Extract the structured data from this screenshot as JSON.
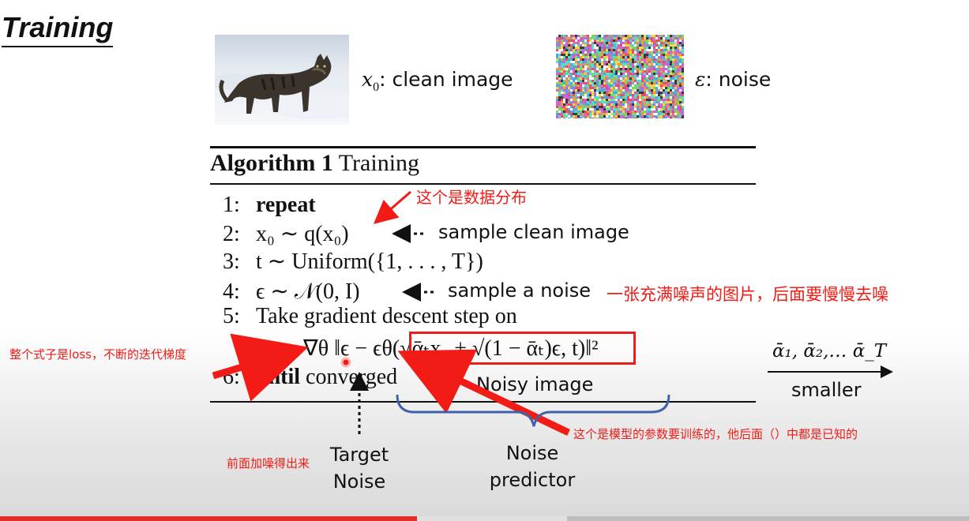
{
  "slide": {
    "title": "Training"
  },
  "images": {
    "clean_caption_var": "x",
    "clean_caption_sub": "0",
    "clean_caption_text": ": clean image",
    "noise_caption_var": "ε",
    "noise_caption_text": ": noise"
  },
  "algorithm": {
    "title_bold": "Algorithm 1",
    "title_rest": " Training",
    "lines": [
      {
        "num": "1:",
        "keyword": "repeat",
        "text": ""
      },
      {
        "num": "2:",
        "text": "x₀ ∼ q(x₀)"
      },
      {
        "num": "3:",
        "text": "t ∼ Uniform({1, . . . , T})"
      },
      {
        "num": "4:",
        "text": "ϵ ∼ 𝒩(0, I)"
      },
      {
        "num": "5:",
        "text": "Take gradient descent step on"
      },
      {
        "num": "6:",
        "keyword": "until",
        "text": " converged"
      }
    ],
    "loss_formula": "∇θ ‖ϵ − ϵθ(√ᾱₜx₀ + √(1 − ᾱₜ)ϵ, t)‖²"
  },
  "annotations": {
    "data_distribution": "这个是数据分布",
    "sample_clean": "sample clean image",
    "sample_noise": "sample a noise",
    "noisy_picture": "一张充满噪声的图片，后面要慢慢去噪",
    "loss_note": "整个式子是loss，不断的迭代梯度",
    "model_params": "这个是模型的参数要训练的，他后面（）中都是已知的",
    "from_noising": "前面加噪得出来",
    "target_noise_1": "Target",
    "target_noise_2": "Noise",
    "noisy_image": "Noisy image",
    "noise_predictor_1": "Noise",
    "noise_predictor_2": "predictor",
    "alpha_seq": "ᾱ₁, ᾱ₂,… ᾱ_T",
    "smaller": "smaller"
  },
  "colors": {
    "annotation_red": "#f21b16",
    "highlight_box": "#e8201b",
    "brace_blue": "#3f63a8",
    "progress_red": "#e52d27"
  },
  "video": {
    "progress": 0.43,
    "buffered": 0.585
  }
}
